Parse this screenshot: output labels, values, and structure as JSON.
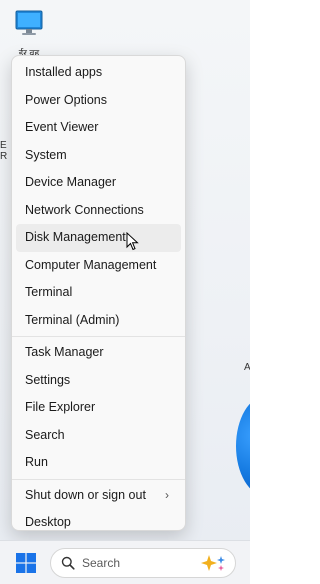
{
  "desktop": {
    "icon_label": "ईर वह",
    "left_fragments": [
      "E",
      "R"
    ],
    "right_fragment": "A"
  },
  "menu": {
    "groups": [
      [
        {
          "label": "Installed apps"
        },
        {
          "label": "Power Options"
        },
        {
          "label": "Event Viewer"
        },
        {
          "label": "System"
        },
        {
          "label": "Device Manager"
        },
        {
          "label": "Network Connections"
        },
        {
          "label": "Disk Management",
          "hovered": true
        },
        {
          "label": "Computer Management"
        },
        {
          "label": "Terminal"
        },
        {
          "label": "Terminal (Admin)"
        }
      ],
      [
        {
          "label": "Task Manager"
        },
        {
          "label": "Settings"
        },
        {
          "label": "File Explorer"
        },
        {
          "label": "Search"
        },
        {
          "label": "Run"
        }
      ],
      [
        {
          "label": "Shut down or sign out",
          "submenu": true
        },
        {
          "label": "Desktop"
        }
      ]
    ]
  },
  "taskbar": {
    "search_placeholder": "Search"
  },
  "colors": {
    "start_blue": "#1a73e8",
    "wallpaper_blue": "#1479e0"
  }
}
